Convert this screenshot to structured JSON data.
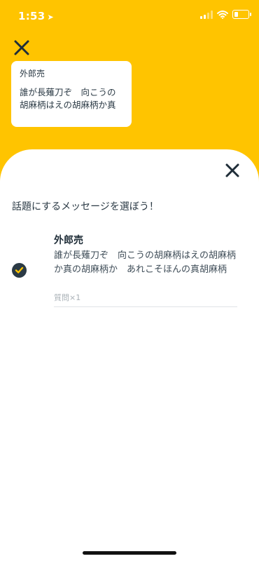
{
  "status_bar": {
    "time": "1:53",
    "location_arrow": "➤"
  },
  "preview_card": {
    "title": "外郎売",
    "body": "誰が長薙刀ぞ　向こうの胡麻柄はえの胡麻柄か真"
  },
  "sheet": {
    "heading": "話題にするメッセージを選ぼう！",
    "messages": [
      {
        "title": "外郎売",
        "body": "誰が長薙刀ぞ　向こうの胡麻柄はえの胡麻柄か真の胡麻柄か　あれこそほんの真胡麻柄",
        "meta": "質問×1",
        "selected": true
      }
    ]
  },
  "colors": {
    "accent": "#ffc400",
    "dark": "#2b3a45",
    "check": "#ffc400"
  },
  "icons": {
    "top_close": "close-icon",
    "sheet_close": "close-icon",
    "check": "check-icon"
  }
}
